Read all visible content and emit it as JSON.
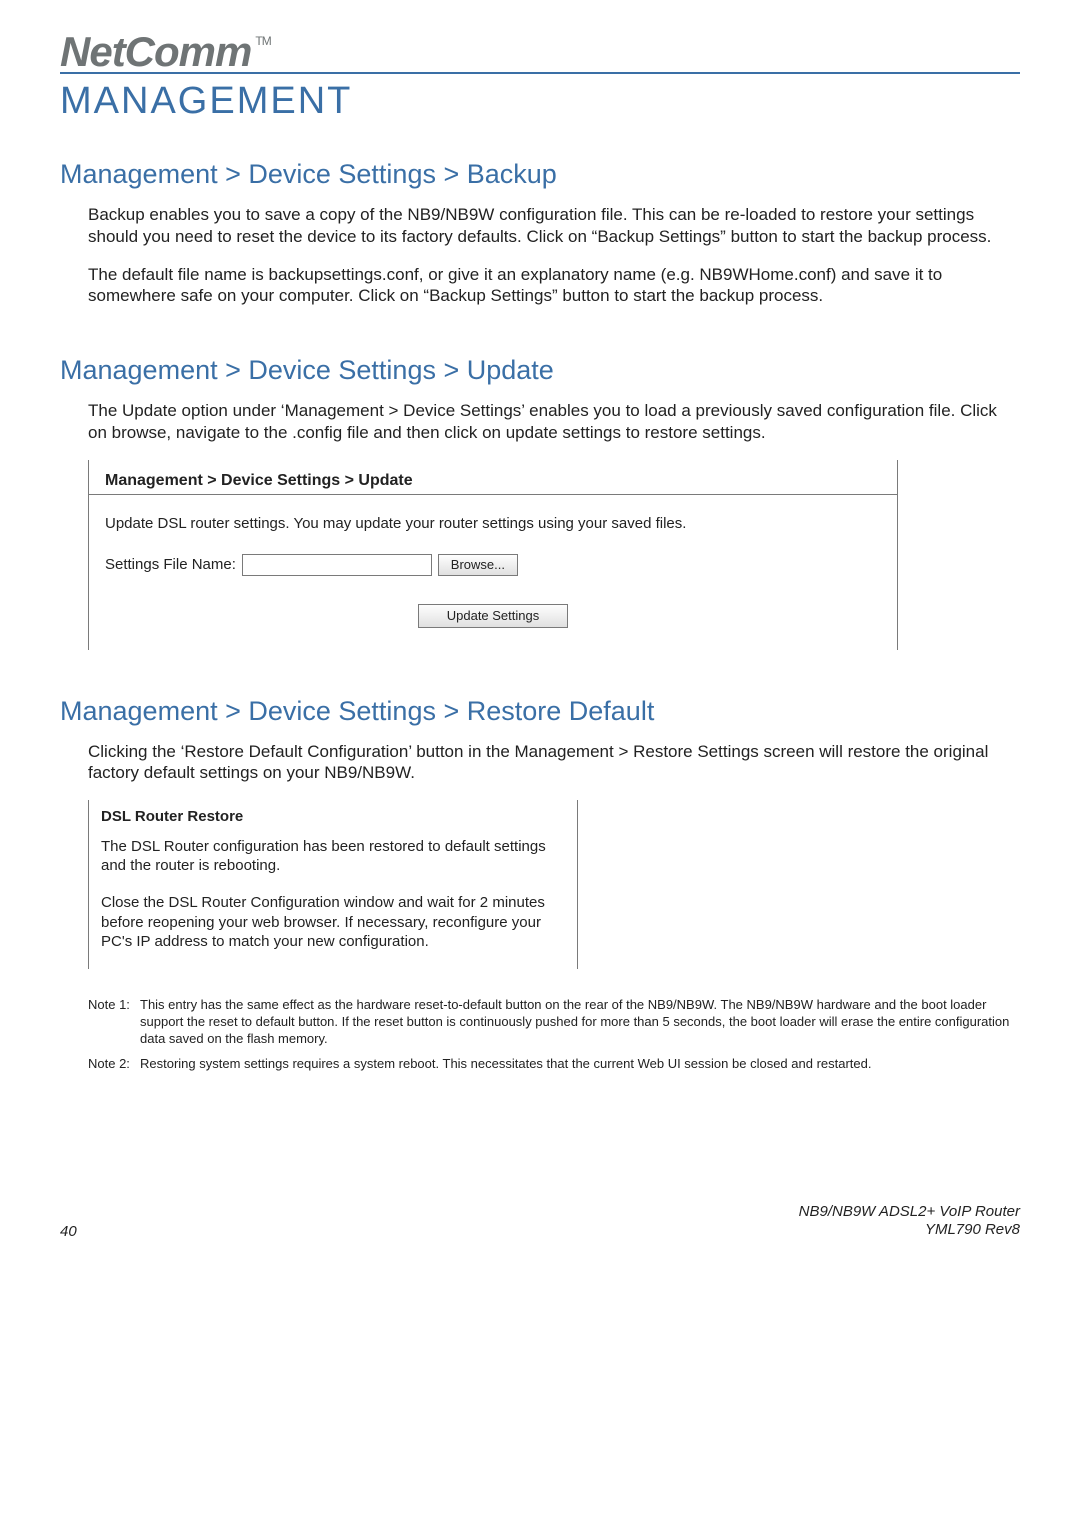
{
  "logo": {
    "brand": "NetComm",
    "tm": "TM"
  },
  "pageTitle": "MANAGEMENT",
  "backup": {
    "heading": "Management > Device Settings > Backup",
    "p1": "Backup enables you to save a copy of the NB9/NB9W configuration file.  This can be re-loaded to restore your settings should you need to reset the device to its factory defaults.  Click on “Backup Settings” button to start the backup process.",
    "p2": "The default file name is backupsettings.conf, or give it an explanatory name (e.g. NB9WHome.conf) and save it to somewhere safe on your computer. Click on “Backup Settings” button to start the backup process."
  },
  "update": {
    "heading": "Management > Device Settings > Update",
    "p1": "The Update option under ‘Management > Device Settings’ enables you to load a previously saved configuration file. Click on browse, navigate to the .config file and then click on update settings to restore settings.",
    "screenshot": {
      "breadcrumb": "Management > Device Settings > Update",
      "desc": "Update DSL router settings. You may update your router settings using your saved files.",
      "fileLabel": "Settings File Name:",
      "browse": "Browse...",
      "updateBtn": "Update Settings"
    }
  },
  "restore": {
    "heading": "Management > Device Settings > Restore Default",
    "p1": "Clicking the ‘Restore Default Configuration’ button in the Management > Restore Settings screen will restore the original factory default settings on your NB9/NB9W.",
    "screenshot": {
      "title": "DSL Router Restore",
      "p1": "The DSL Router configuration has been restored to default settings and the router is rebooting.",
      "p2": "Close the DSL Router Configuration window and wait for 2 minutes before reopening your web browser. If necessary, reconfigure your PC's IP address to match your new configuration."
    },
    "notes": {
      "n1label": "Note 1:",
      "n1text": "This entry has the same effect as the hardware reset-to-default button on the rear of the NB9/NB9W. The NB9/NB9W hardware and the boot loader support the reset to default button. If the reset button is continuously pushed for more than 5 seconds, the boot loader will erase the entire configuration data saved on the flash memory.",
      "n2label": "Note 2:",
      "n2text": "Restoring system settings requires a system reboot. This necessitates that the current Web UI session be closed and restarted."
    }
  },
  "footer": {
    "pageNum": "40",
    "productLine1": "NB9/NB9W ADSL2+ VoIP Router",
    "productLine2": "YML790 Rev8"
  }
}
